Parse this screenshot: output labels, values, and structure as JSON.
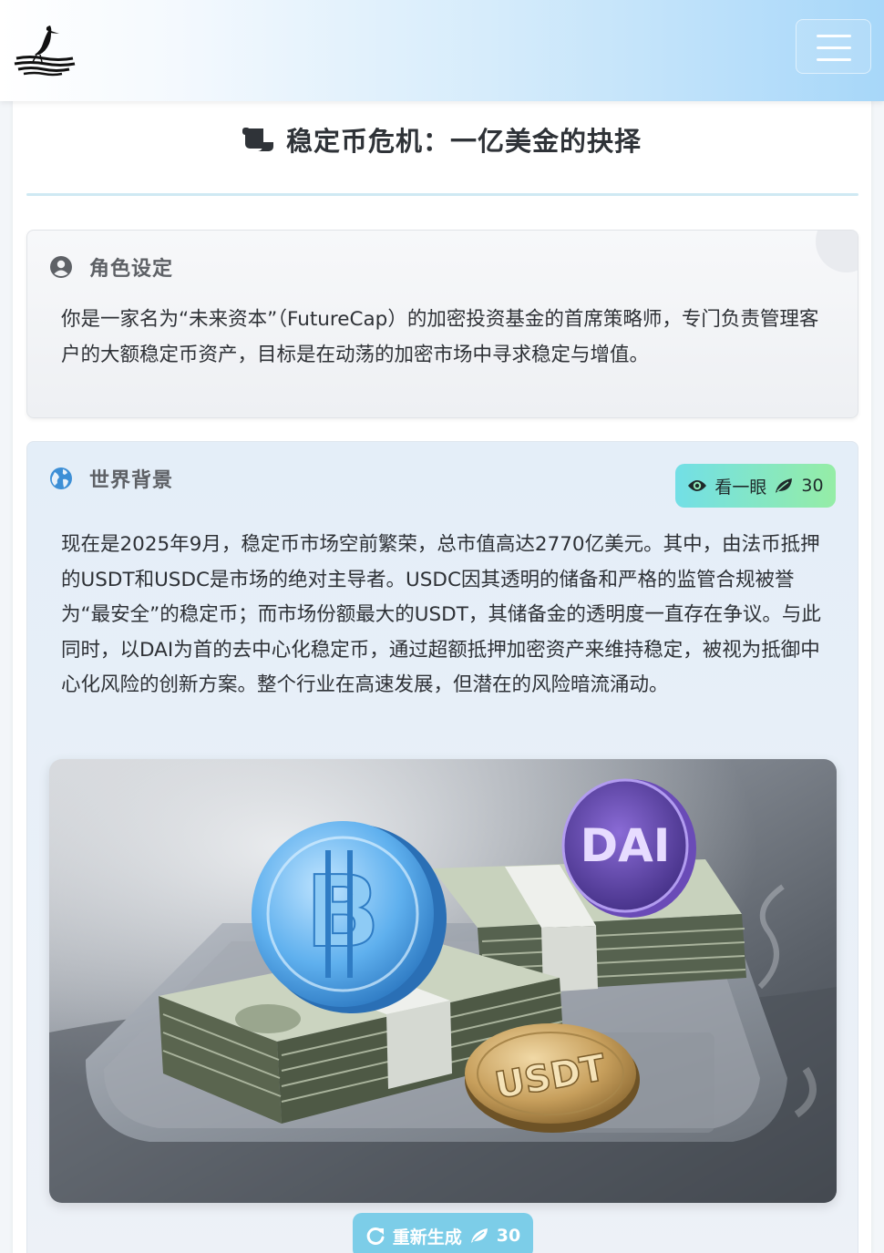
{
  "header": {
    "logo_icon": "heron-on-water-logo",
    "menu_icon": "hamburger-menu-icon"
  },
  "page": {
    "title_icon": "scroll-icon",
    "title": "稳定币危机：一亿美金的抉择"
  },
  "role": {
    "icon": "user-circle-icon",
    "heading": "角色设定",
    "text": "你是一家名为“未来资本”（FutureCap）的加密投资基金的首席策略师，专门负责管理客户的大额稳定币资产，目标是在动荡的加密市场中寻求稳定与增值。"
  },
  "world": {
    "icon": "globe-icon",
    "heading": "世界背景",
    "peek_button": {
      "icon": "eye-icon",
      "label": "看一眼",
      "cost_icon": "leaf-icon",
      "cost": "30"
    },
    "text": "现在是2025年9月，稳定币市场空前繁荣，总市值高达2770亿美元。其中，由法币抵押的USDT和USDC是市场的绝对主导者。USDC因其透明的储备和严格的监管合规被誉为“最安全”的稳定币；而市场份额最大的USDT，其储备金的透明度一直存在争议。与此同时，以DAI为首的去中心化稳定币，通过超额抵押加密资产来维持稳定，被视为抵御中心化风险的创新方案。整个行业在高速发展，但潜在的风险暗流涌动。",
    "image": {
      "coin_labels": [
        "DAI",
        "USDT"
      ]
    },
    "regenerate_button": {
      "icon": "redo-icon",
      "label": "重新生成",
      "cost_icon": "leaf-icon",
      "cost": "30"
    }
  },
  "colors": {
    "accent_teal": "#72dfe6",
    "accent_green": "#95eda6",
    "regen_blue": "#7ccde8",
    "globe_blue": "#3d8fd6"
  }
}
